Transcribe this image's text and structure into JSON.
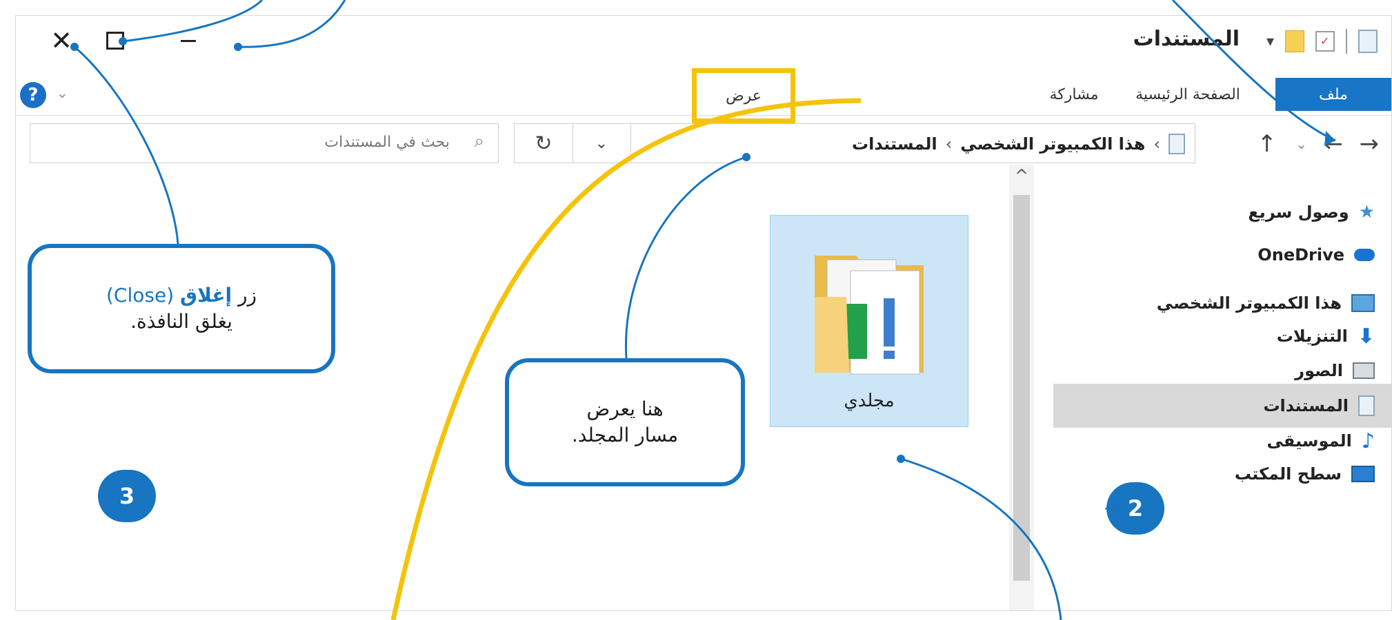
{
  "window": {
    "title": "المستندات",
    "controls": {
      "close": "✕",
      "maximize": "☐",
      "minimize": "—"
    },
    "qat_divider": "|",
    "qat_dropdown": "▾"
  },
  "ribbon": {
    "tabs": [
      {
        "id": "file",
        "label": "ملف"
      },
      {
        "id": "home",
        "label": "الصفحة الرئيسية"
      },
      {
        "id": "share",
        "label": "مشاركة"
      },
      {
        "id": "view",
        "label": "عرض"
      }
    ],
    "help": "?",
    "expand": "⌄"
  },
  "address": {
    "crumbs": [
      "هذا الكمبيوتر الشخصي",
      "المستندات"
    ],
    "separator": "›",
    "dropdown": "⌄",
    "refresh": "↻",
    "back": "←",
    "forward": "→",
    "up": "↑",
    "recent": "⌄"
  },
  "search": {
    "placeholder": "بحث في المستندات",
    "icon": "⌕"
  },
  "sidebar": {
    "items": [
      {
        "label": "وصول سريع",
        "icon": "star-icon"
      },
      {
        "label": "OneDrive",
        "icon": "cloud-icon"
      },
      {
        "label": "هذا الكمبيوتر الشخصي",
        "icon": "computer-icon"
      },
      {
        "label": "التنزيلات",
        "icon": "download-icon"
      },
      {
        "label": "الصور",
        "icon": "pictures-icon"
      },
      {
        "label": "المستندات",
        "icon": "documents-icon",
        "selected": true
      },
      {
        "label": "الموسيقى",
        "icon": "music-icon"
      },
      {
        "label": "سطح المكتب",
        "icon": "desktop-icon"
      }
    ],
    "scroll_up": "^"
  },
  "content": {
    "folder": {
      "label": "مجلدي",
      "icon": "folder-icon"
    }
  },
  "callouts": {
    "close_prefix": "زر ",
    "close_bold": "إغلاق",
    "close_paren": " (Close)",
    "close_line2": "يغلق النافذة.",
    "path_line1": "هنا يعرض",
    "path_line2": "مسار المجلد."
  },
  "badges": {
    "step2": "2",
    "step3": "3"
  },
  "colors": {
    "accent": "#1775c1",
    "highlight": "#f5c30a",
    "file_tab": "#1975c6",
    "folder_tile": "#cce6f8"
  }
}
